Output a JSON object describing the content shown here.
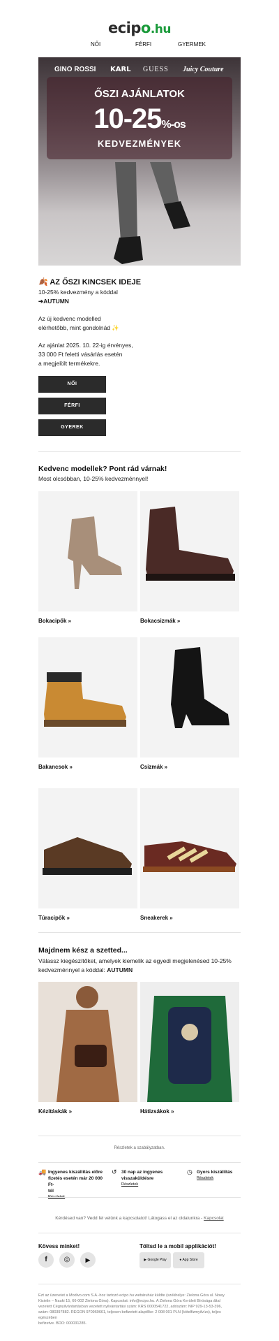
{
  "logo": {
    "main": "ecip",
    "o": "o",
    "tld": ".hu"
  },
  "nav": [
    "NŐI",
    "FÉRFI",
    "GYERMEK"
  ],
  "hero": {
    "brands": [
      "GINO ROSSI",
      "KARL",
      "GUESS",
      "Juicy Couture"
    ],
    "line1": "ŐSZI AJÁNLATOK",
    "line2": "10-25",
    "line2_suffix": "%-os",
    "line3": "KEDVEZMÉNYEK"
  },
  "intro": {
    "title": "🍂 AZ ŐSZI KINCSEK IDEJE",
    "line1": "10-25% kedvezmény a kóddal",
    "code": "➔AUTUMN",
    "p1a": "Az új kedvenc modelled",
    "p1b": "elérhetőbb, mint gondolnád ✨",
    "p2a": "Az ajánlat 2025. 10. 22-ig érvényes,",
    "p2b": "33 000 Ft feletti vásárlás esetén",
    "p2c": "a megjelölt termékekre."
  },
  "buttons": [
    "NŐI",
    "FÉRFI",
    "GYEREK"
  ],
  "favorites": {
    "title": "Kedvenc modellek? Pont rád várnak!",
    "subtitle": "Most olcsóbban, 10-25% kedvezménnyel!"
  },
  "products": [
    {
      "label": "Bokacipők »",
      "icon": "ankle-boot-icon"
    },
    {
      "label": "Bokacsizmák »",
      "icon": "chelsea-boot-icon"
    },
    {
      "label": "Bakancsok »",
      "icon": "work-boot-icon"
    },
    {
      "label": "Csizmák »",
      "icon": "cowboy-boot-icon"
    },
    {
      "label": "Túracipők »",
      "icon": "hiking-shoe-icon"
    },
    {
      "label": "Sneakerek »",
      "icon": "sneaker-icon"
    }
  ],
  "accessories": {
    "title": "Majdnem kész a szetted...",
    "text1": "Válassz kiegészítőket, amelyek kiemelik az egyedi megjelenésed 10-25%",
    "text2": "kedvezménnyel a kóddal: ",
    "code": "AUTUMN",
    "items": [
      {
        "label": "Kézitáskák »"
      },
      {
        "label": "Hátizsákok »"
      }
    ]
  },
  "rules": "Részletek a szabályzatban.",
  "benefits": [
    {
      "l1": "Ingyenes kiszállítás előre",
      "l2": "fizetés esetén már 20 000 Ft-",
      "l3": "tól",
      "more": "Részletek"
    },
    {
      "l1": "30 nap az ingyenes",
      "l2": "visszaküldésre",
      "l3": "",
      "more": "Részletek"
    },
    {
      "l1": "Gyors kiszállítás",
      "l2": "",
      "l3": "",
      "more": "Részletek"
    }
  ],
  "question": {
    "text": "Kérdésed van? Vedd fel velünk a kapcsolatot! Látogass el az oldalunkra - ",
    "link": "Kapcsolat"
  },
  "follow": "Kövess minket!",
  "app": "Töltsd le a mobil applikációt!",
  "stores": [
    "Google Play",
    "App Store"
  ],
  "footer": [
    "Ezt az üzenetet a Modivo.com S.A.-hoz tartozó ecipo.hu webáruház küldte (székhelye: Zielona Góra ul. Nowy",
    "Kisielin – Nauki 15, 66-002 Zielona Góra). Kapcsolat: info@ecipo.hu. A Zielona Góra Kerületi Bírósága által",
    "vezetett Cégnyilvántartásban vezetett nyilvántartási szám: KRS 0000541722, adószám: NIP 929-13-53-396,",
    "szám: 080397882. REGON 970969661, teljesen befizetett alaptőke: 2 008 001 PLN (kötelfizmyilvízs), teljes egészében",
    "befizetve. BDO: 000031285."
  ],
  "colors": {
    "brand": "#1a9a3a",
    "button": "#2b2b2b"
  }
}
